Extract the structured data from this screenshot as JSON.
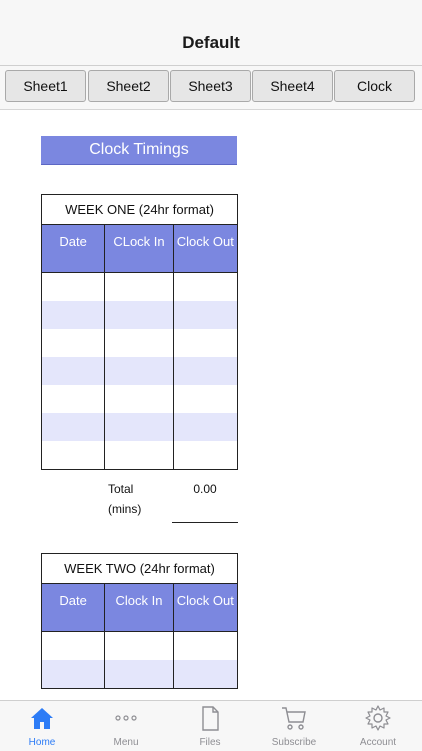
{
  "nav": {
    "title": "Default"
  },
  "tabs": [
    {
      "label": "Sheet1"
    },
    {
      "label": "Sheet2"
    },
    {
      "label": "Sheet3"
    },
    {
      "label": "Sheet4"
    },
    {
      "label": "Clock"
    }
  ],
  "section": {
    "title": "Clock Timings"
  },
  "week_one": {
    "title": "WEEK ONE (24hr format)",
    "headers": [
      "Date",
      "CLock In",
      "Clock Out"
    ],
    "total_label": "Total (mins)",
    "total_value": "0.00"
  },
  "week_two": {
    "title": "WEEK TWO (24hr format)",
    "headers": [
      "Date",
      "Clock In",
      "Clock Out"
    ]
  },
  "tabbar": {
    "items": [
      {
        "label": "Home",
        "icon": "home-icon",
        "active": true
      },
      {
        "label": "Menu",
        "icon": "more-icon"
      },
      {
        "label": "Files",
        "icon": "file-icon"
      },
      {
        "label": "Subscribe",
        "icon": "cart-icon"
      },
      {
        "label": "Account",
        "icon": "gear-icon"
      }
    ]
  },
  "colors": {
    "accent": "#7b87e0",
    "row_alt": "#e4e6fb",
    "active_tab": "#2d7cf6",
    "inactive_tab": "#8e8e93"
  }
}
